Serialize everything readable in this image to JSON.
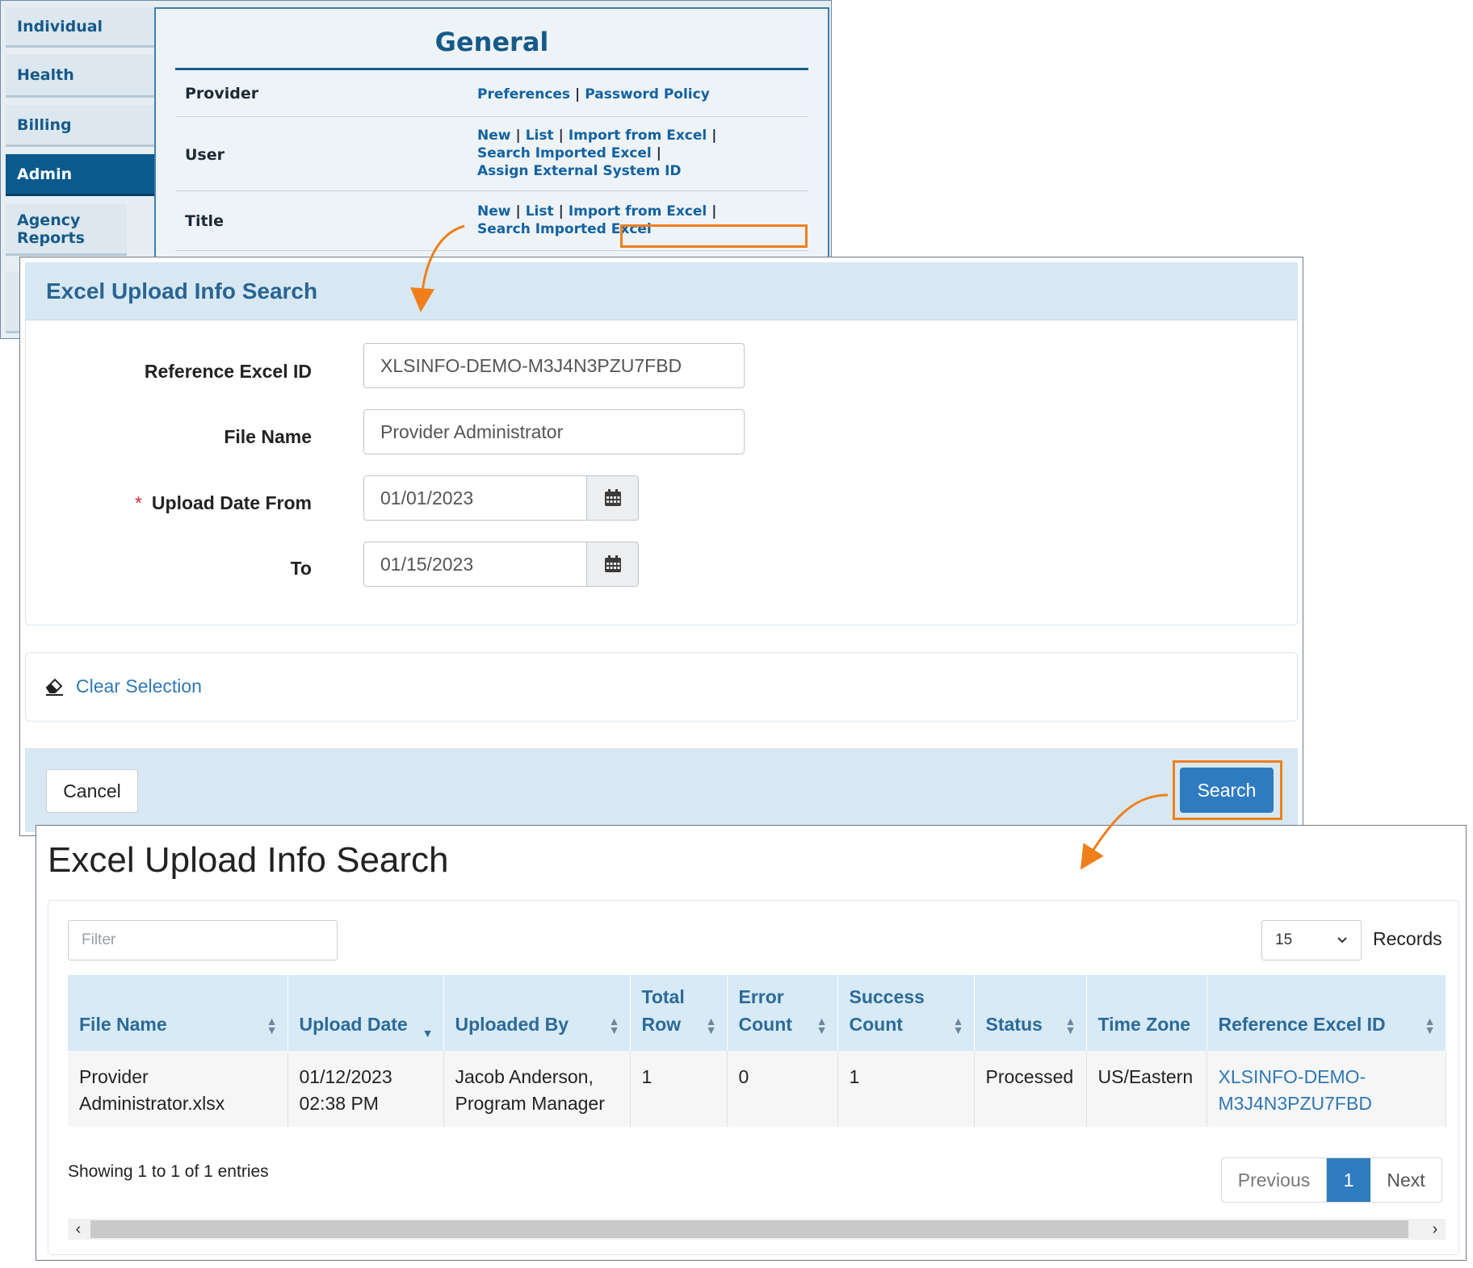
{
  "sidebar": {
    "items": [
      "Individual",
      "Health",
      "Billing",
      "Admin",
      "Agency Reports"
    ]
  },
  "general": {
    "title": "General",
    "rows": [
      {
        "label": "Provider",
        "links": [
          "Preferences",
          "Password Policy"
        ]
      },
      {
        "label": "User",
        "links": [
          "New",
          "List",
          "Import from Excel",
          "Search Imported Excel",
          "Assign External System ID"
        ]
      },
      {
        "label": "Title",
        "links": [
          "New",
          "List",
          "Import from Excel",
          "Search Imported Excel"
        ]
      }
    ]
  },
  "search_form": {
    "title": "Excel Upload Info Search",
    "reference_label": "Reference Excel ID",
    "reference_value": "XLSINFO-DEMO-M3J4N3PZU7FBD",
    "file_label": "File Name",
    "file_value": "Provider Administrator",
    "required_mark": "*",
    "date_from_label": "Upload Date From",
    "date_from_value": "01/01/2023",
    "date_to_label": "To",
    "date_to_value": "01/15/2023",
    "clear_label": "Clear Selection",
    "cancel_label": "Cancel",
    "search_label": "Search"
  },
  "results": {
    "title": "Excel Upload Info Search",
    "filter_placeholder": "Filter",
    "page_size": "15",
    "records_label": "Records",
    "columns": [
      {
        "line1": "",
        "line2": "File Name"
      },
      {
        "line1": "",
        "line2": "Upload Date"
      },
      {
        "line1": "",
        "line2": "Uploaded By"
      },
      {
        "line1": "Total",
        "line2": "Row"
      },
      {
        "line1": "Error",
        "line2": "Count"
      },
      {
        "line1": "Success",
        "line2": "Count"
      },
      {
        "line1": "",
        "line2": "Status"
      },
      {
        "line1": "",
        "line2": "Time Zone"
      },
      {
        "line1": "",
        "line2": "Reference Excel ID"
      }
    ],
    "row": {
      "file_name": [
        "Provider",
        "Administrator.xlsx"
      ],
      "upload_date": [
        "01/12/2023",
        "02:38 PM"
      ],
      "uploaded_by": [
        "Jacob Anderson,",
        "Program Manager"
      ],
      "total_row": "1",
      "error_count": "0",
      "success_count": "1",
      "status": "Processed",
      "time_zone": "US/Eastern",
      "reference_id": [
        "XLSINFO-DEMO-",
        "M3J4N3PZU7FBD"
      ]
    },
    "showing": "Showing 1 to 1 of 1 entries",
    "previous": "Previous",
    "page": "1",
    "next": "Next"
  },
  "colors": {
    "accent_orange": "#f07f1b",
    "primary_blue": "#2f7bc0",
    "nav_blue": "#0b5a8c"
  }
}
